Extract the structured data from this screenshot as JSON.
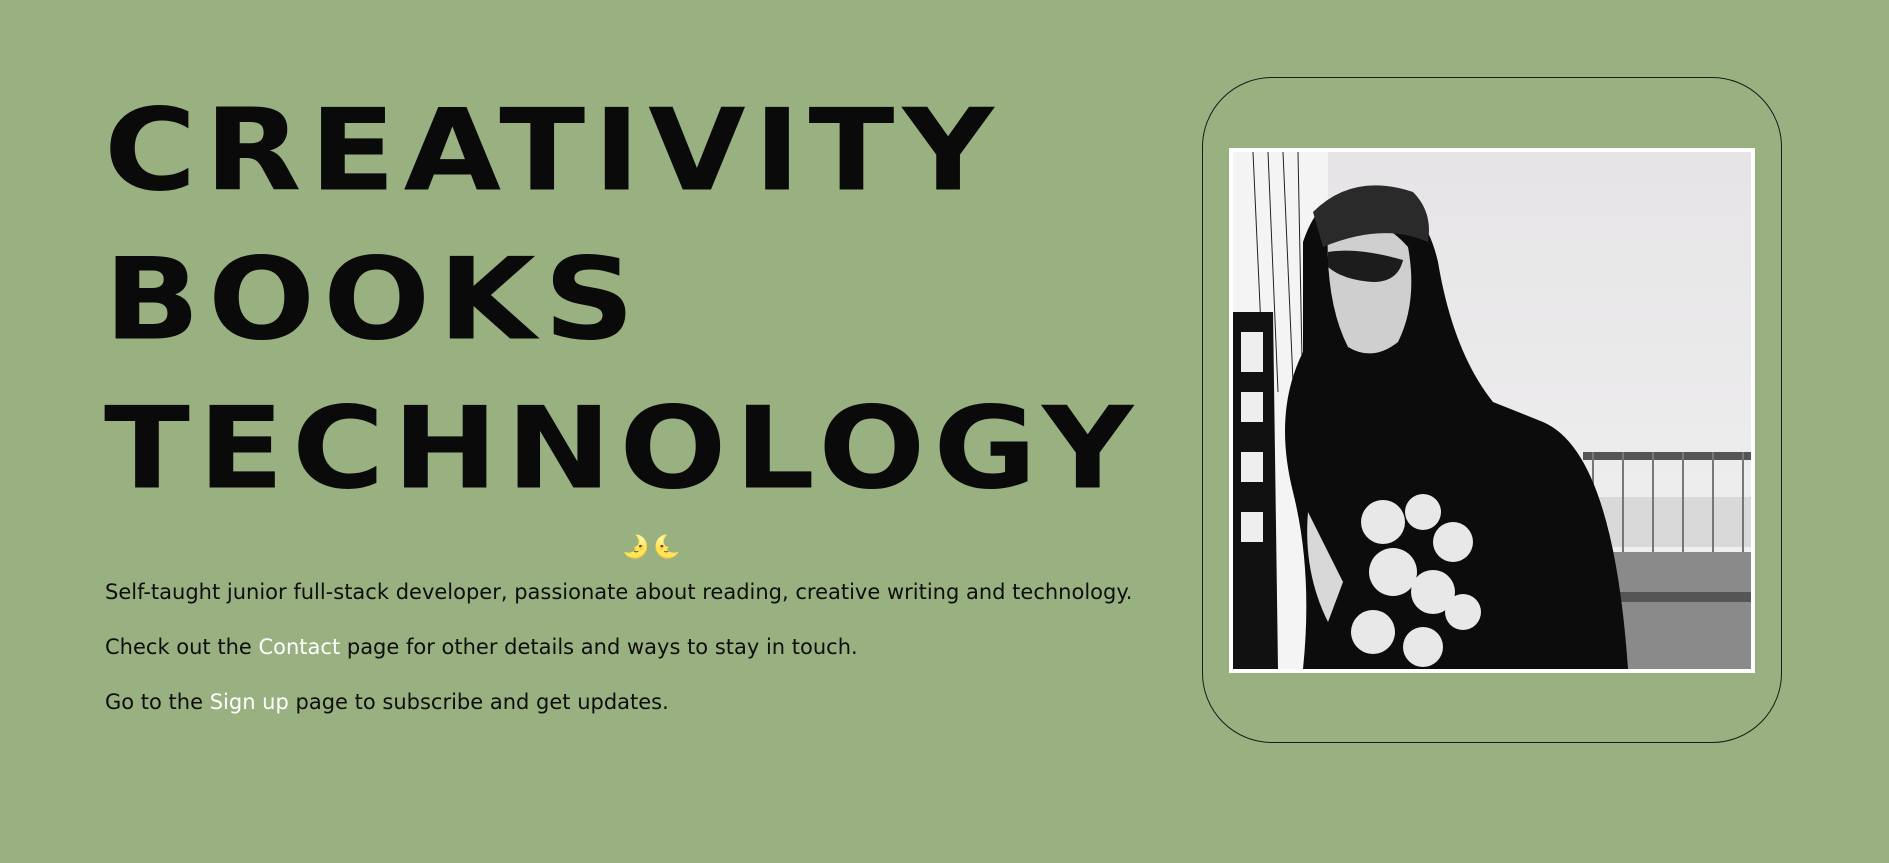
{
  "hero": {
    "lines": [
      "CREATIVITY",
      "BOOKS",
      "TECHNOLOGY"
    ]
  },
  "decoration": {
    "moons": "🌛🌜",
    "moons_color": "#e7c235"
  },
  "intro": {
    "line1": "Self-taught junior full-stack developer, passionate about reading, creative writing and technology.",
    "line2_before": "Check out the ",
    "contact_link": "Contact",
    "line2_after": " page for other details and ways to stay in touch.",
    "line3_before": "Go to the ",
    "signup_link": "Sign up",
    "line3_after": " page to subscribe and get updates."
  },
  "photo": {
    "description_icon": "portrait-photo"
  },
  "colors": {
    "background": "#99b181",
    "text": "#0a0a0a",
    "link": "#ffffff",
    "frame_border": "#1a1a1a"
  }
}
